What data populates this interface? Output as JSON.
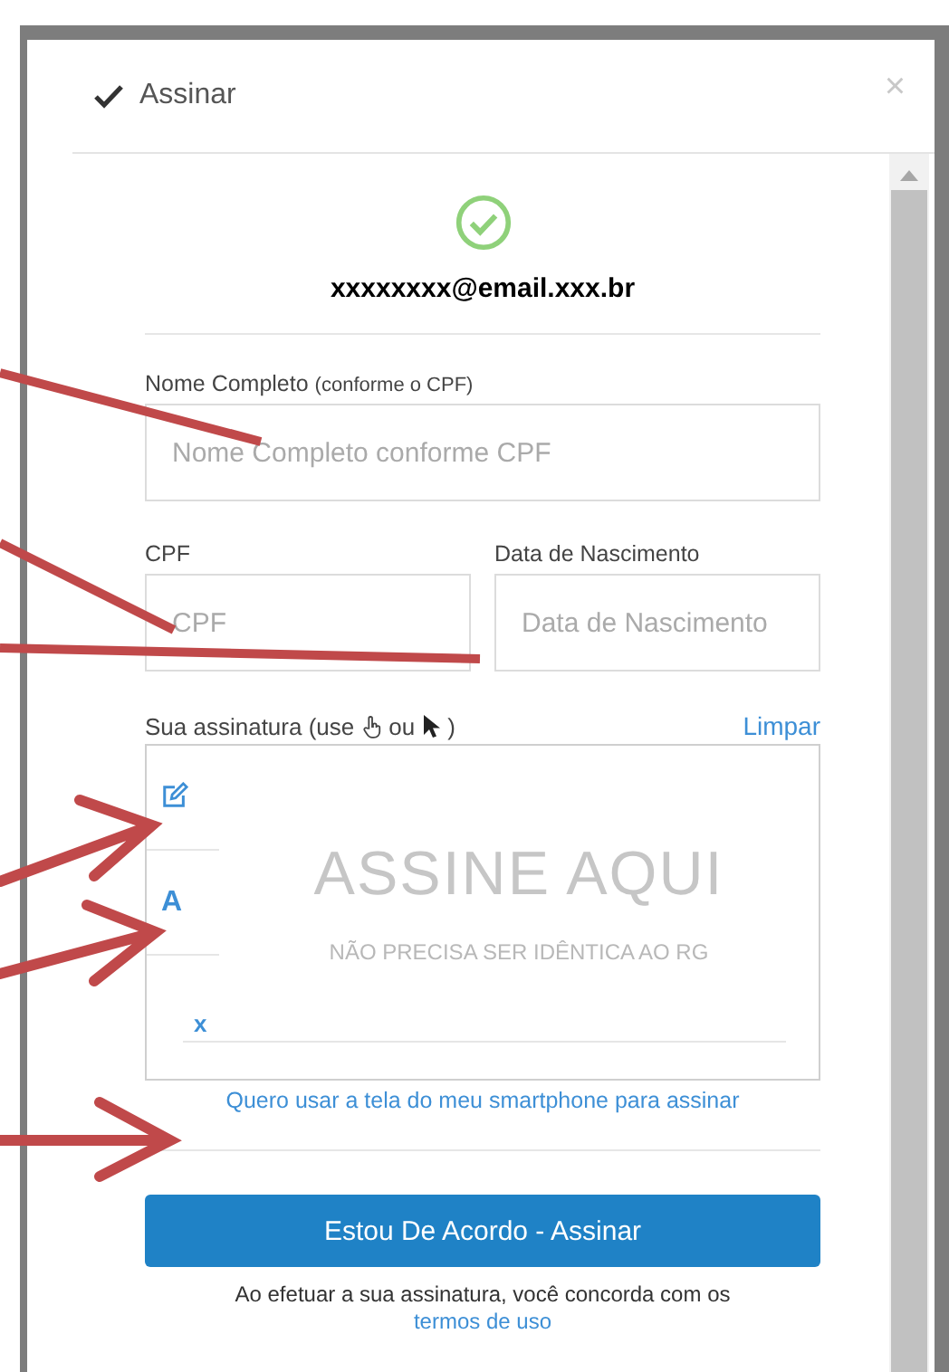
{
  "dialog": {
    "title": "Assinar",
    "close": "×"
  },
  "signer": {
    "email": "xxxxxxxx@email.xxx.br"
  },
  "fields": [
    {
      "label": "Nome Completo",
      "hint": "(conforme o CPF)",
      "placeholder": "Nome Completo conforme CPF"
    },
    {
      "label": "CPF",
      "placeholder": "CPF"
    },
    {
      "label": "Data de Nascimento",
      "placeholder": "Data de Nascimento"
    }
  ],
  "signature": {
    "label_start": "Sua assinatura (use",
    "label_mid": "ou",
    "label_end": ")",
    "clear": "Limpar",
    "watermark": "ASSINE AQUI",
    "watermark_sub": "NÃO PRECISA SER IDÊNTICA AO RG",
    "type_mode": "A",
    "baseline_mark": "x"
  },
  "smartphone_link": "Quero usar a tela do meu smartphone para assinar",
  "submit": "Estou De Acordo - Assinar",
  "terms_note": "Ao efetuar a sua assinatura, você concorda com os",
  "terms_link": "termos de uso"
}
